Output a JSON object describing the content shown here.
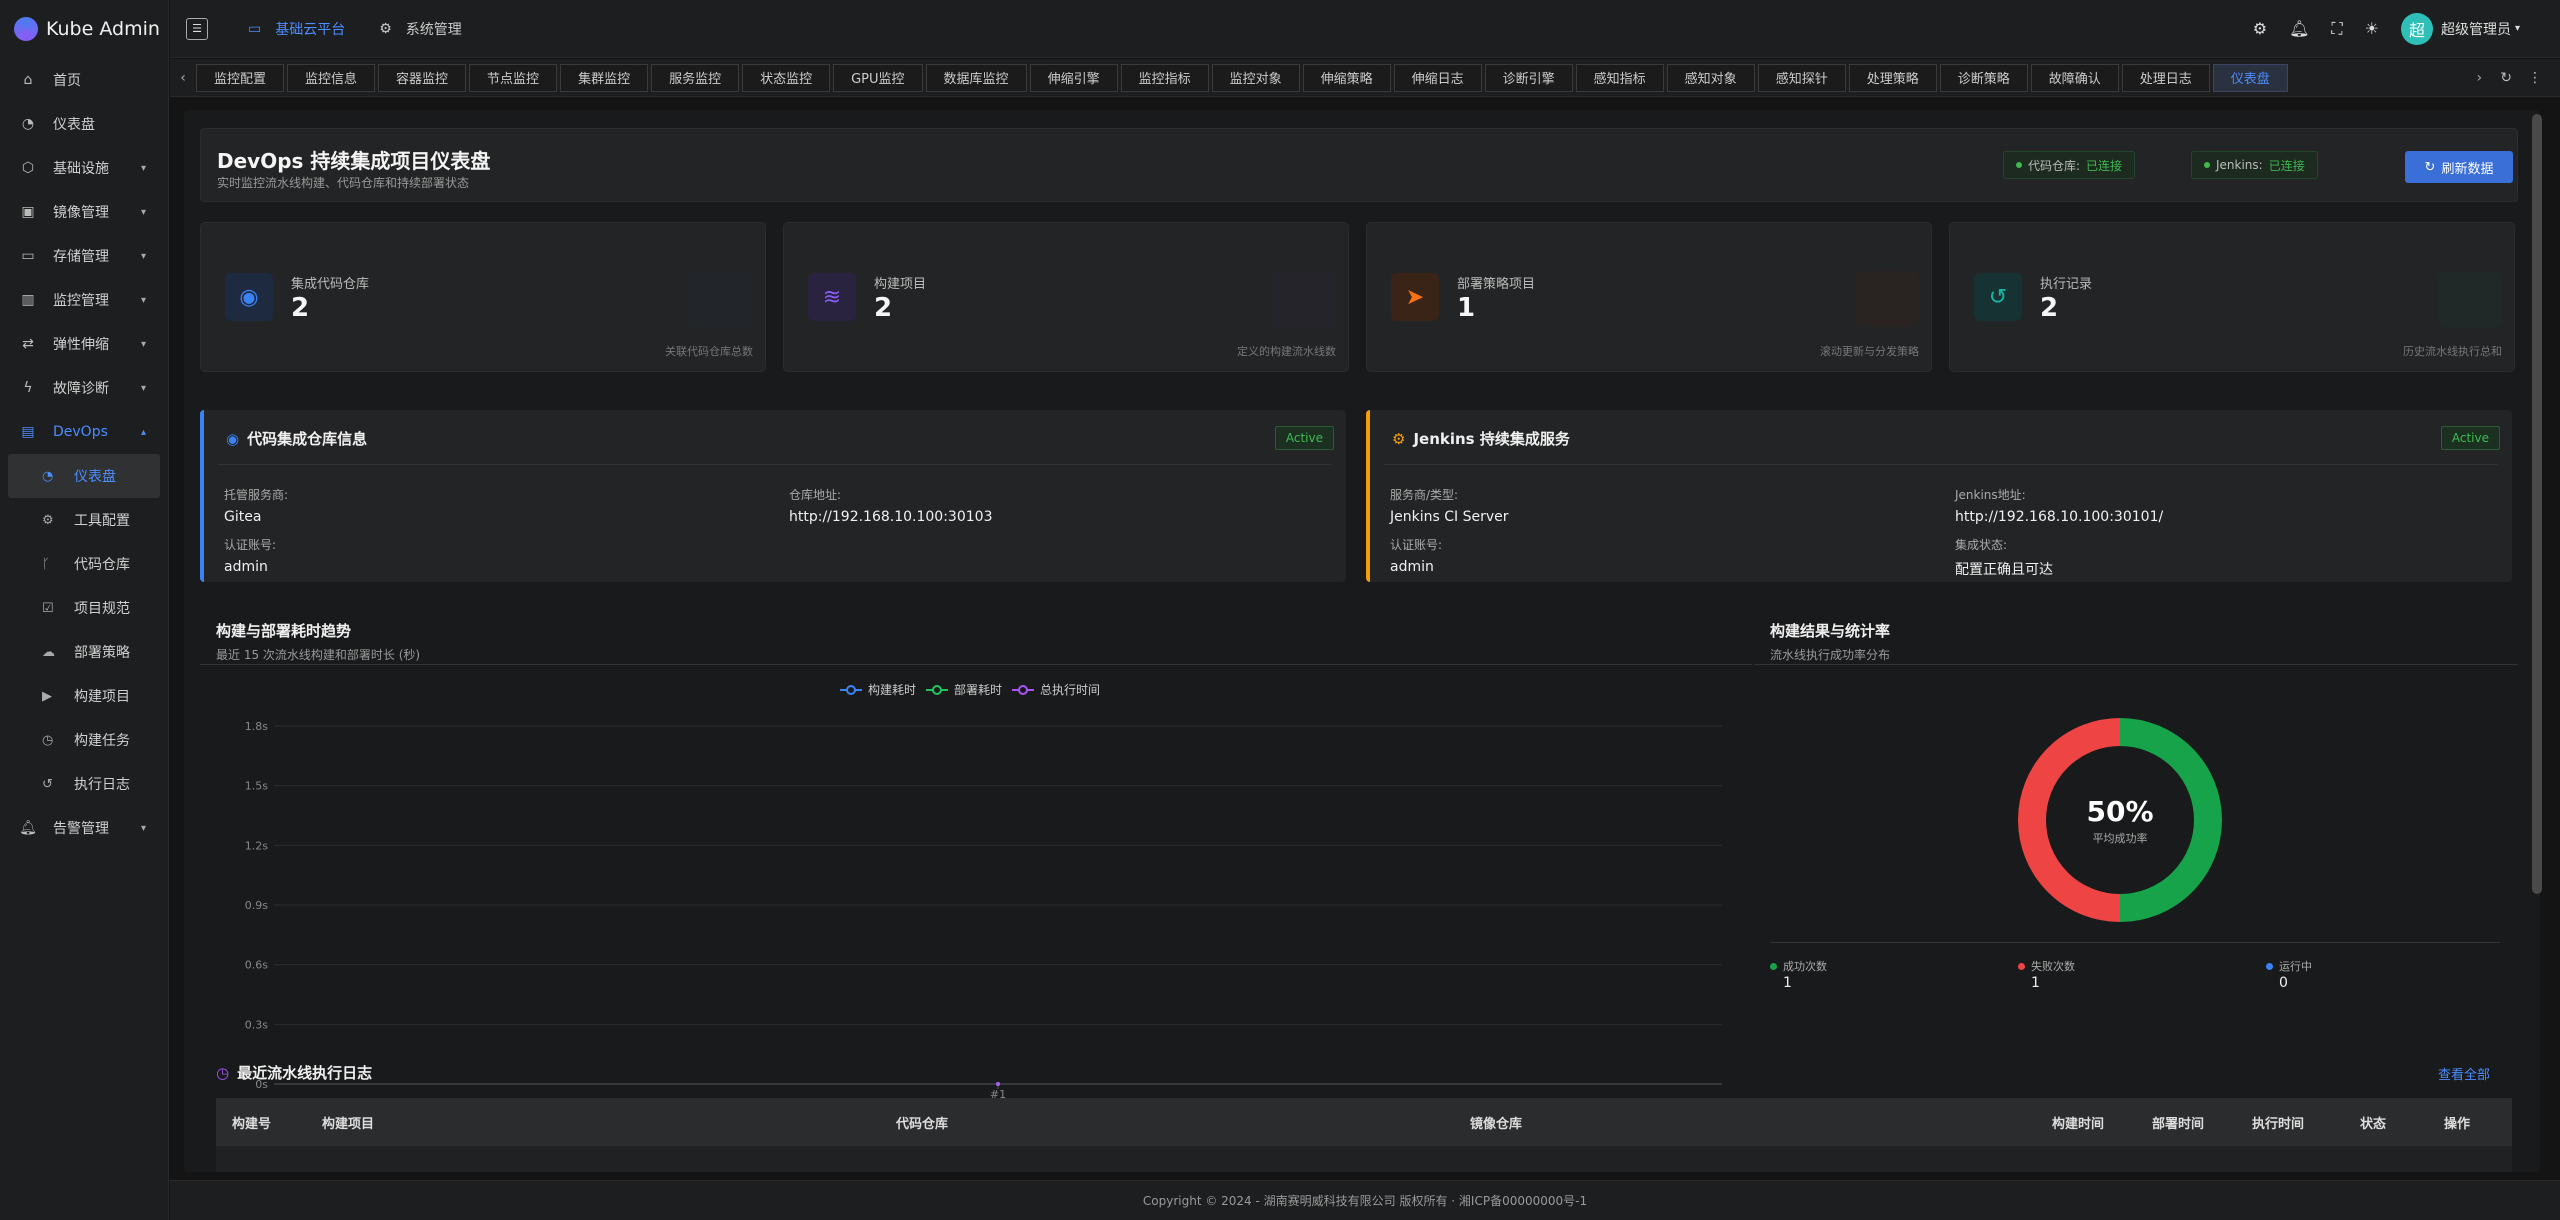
{
  "app": {
    "title": "Kube Admin"
  },
  "sidebar": {
    "items": [
      {
        "label": "首页",
        "icon": "home-icon"
      },
      {
        "label": "仪表盘",
        "icon": "dashboard-icon"
      },
      {
        "label": "基础设施",
        "icon": "cube-icon"
      },
      {
        "label": "镜像管理",
        "icon": "box-icon"
      },
      {
        "label": "存储管理",
        "icon": "folder-icon"
      },
      {
        "label": "监控管理",
        "icon": "chart-icon"
      },
      {
        "label": "弹性伸缩",
        "icon": "swap-icon"
      },
      {
        "label": "故障诊断",
        "icon": "bolt-icon"
      },
      {
        "label": "DevOps",
        "icon": "devops-icon"
      },
      {
        "label": "告警管理",
        "icon": "bell-icon"
      }
    ],
    "devops_children": [
      {
        "label": "仪表盘"
      },
      {
        "label": "工具配置"
      },
      {
        "label": "代码仓库"
      },
      {
        "label": "项目规范"
      },
      {
        "label": "部署策略"
      },
      {
        "label": "构建项目"
      },
      {
        "label": "构建任务"
      },
      {
        "label": "执行日志"
      }
    ]
  },
  "header": {
    "nav": [
      {
        "label": "基础云平台"
      },
      {
        "label": "系统管理"
      }
    ],
    "avatar": "超",
    "username": "超级管理员"
  },
  "tabs": [
    "监控配置",
    "监控信息",
    "容器监控",
    "节点监控",
    "集群监控",
    "服务监控",
    "状态监控",
    "GPU监控",
    "数据库监控",
    "伸缩引擎",
    "监控指标",
    "监控对象",
    "伸缩策略",
    "伸缩日志",
    "诊断引擎",
    "感知指标",
    "感知对象",
    "感知探针",
    "处理策略",
    "诊断策略",
    "故障确认",
    "处理日志",
    "仪表盘"
  ],
  "banner": {
    "title": "DevOps 持续集成项目仪表盘",
    "subtitle": "实时监控流水线构建、代码仓库和持续部署状态",
    "repo_label": "代码仓库:",
    "repo_status": "已连接",
    "jenkins_label": "Jenkins:",
    "jenkins_status": "已连接",
    "refresh": "刷新数据"
  },
  "stats": [
    {
      "label": "集成代码仓库",
      "value": "2",
      "note": "关联代码仓库总数",
      "color": "#3b82f6"
    },
    {
      "label": "构建项目",
      "value": "2",
      "note": "定义的构建流水线数",
      "color": "#8b5cf6"
    },
    {
      "label": "部署策略项目",
      "value": "1",
      "note": "滚动更新与分发策略",
      "color": "#f97316"
    },
    {
      "label": "执行记录",
      "value": "2",
      "note": "历史流水线执行总和",
      "color": "#14b8a6"
    }
  ],
  "repo_panel": {
    "title": "代码集成仓库信息",
    "badge": "Active",
    "host_label": "托管服务商:",
    "host": "Gitea",
    "url_label": "仓库地址:",
    "url": "http://192.168.10.100:30103",
    "account_label": "认证账号:",
    "account": "admin"
  },
  "jenkins_panel": {
    "title": "Jenkins 持续集成服务",
    "badge": "Active",
    "type_label": "服务商/类型:",
    "type": "Jenkins CI Server",
    "url_label": "Jenkins地址:",
    "url": "http://192.168.10.100:30101/",
    "account_label": "认证账号:",
    "account": "admin",
    "status_label": "集成状态:",
    "status": "配置正确且可达"
  },
  "trend": {
    "title": "构建与部署耗时趋势",
    "subtitle": "最近 15 次流水线构建和部署时长 (秒)"
  },
  "result": {
    "title": "构建结果与统计率",
    "subtitle": "流水线执行成功率分布",
    "center_value": "50%",
    "center_label": "平均成功率",
    "success_label": "成功次数",
    "success": "1",
    "fail_label": "失败次数",
    "fail": "1",
    "running_label": "运行中",
    "running": "0"
  },
  "chart_data": [
    {
      "type": "line",
      "x": [
        "#1"
      ],
      "series": [
        {
          "name": "构建耗时",
          "values": [
            0
          ],
          "color": "#3b82f6"
        },
        {
          "name": "部署耗时",
          "values": [
            0
          ],
          "color": "#22c55e"
        },
        {
          "name": "总执行时间",
          "values": [
            0
          ],
          "color": "#a855f7"
        }
      ],
      "yticks": [
        "1.8s",
        "1.5s",
        "1.2s",
        "0.9s",
        "0.6s",
        "0.3s",
        "0s"
      ],
      "ylim": [
        0,
        1.8
      ],
      "grid": true,
      "legend": "top-center"
    },
    {
      "type": "pie",
      "categories": [
        "成功次数",
        "失败次数"
      ],
      "values": [
        1,
        1
      ],
      "colors": [
        "#16a34a",
        "#ef4444"
      ]
    }
  ],
  "logs": {
    "title": "最近流水线执行日志",
    "view_all": "查看全部",
    "columns": [
      "构建号",
      "构建项目",
      "代码仓库",
      "镜像仓库",
      "构建时间",
      "部署时间",
      "执行时间",
      "状态",
      "操作"
    ]
  },
  "footer": "Copyright © 2024 - 湖南赛明威科技有限公司 版权所有 · 湘ICP备00000000号-1"
}
